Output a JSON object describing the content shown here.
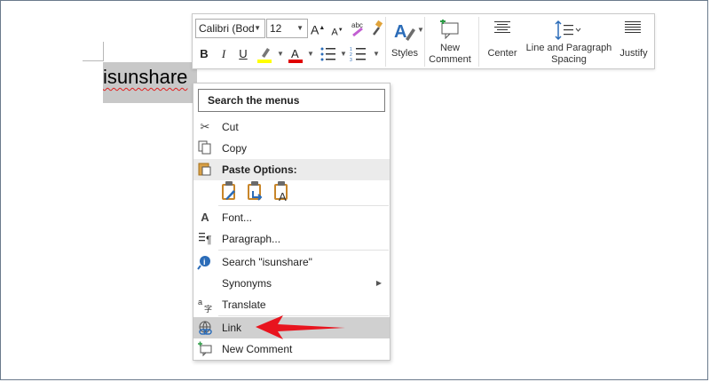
{
  "document": {
    "selected_word": "isunshare"
  },
  "mini_toolbar": {
    "font_name": "Calibri (Bod",
    "font_size": "12",
    "bold": "B",
    "italic": "I",
    "underline": "U",
    "styles_label": "Styles",
    "new_comment_label_1": "New",
    "new_comment_label_2": "Comment",
    "center_label": "Center",
    "line_spacing_label_1": "Line and Paragraph",
    "line_spacing_label_2": "Spacing",
    "justify_label": "Justify",
    "grow_font": "A",
    "shrink_font": "A",
    "font_color_letter": "A",
    "colors": {
      "highlight": "#ffff00",
      "font_color": "#e00000",
      "styles_accent": "#2b6cb8",
      "comment_accent": "#2e9b47"
    }
  },
  "context_menu": {
    "search_label": "Search the menus",
    "items": [
      {
        "label": "Cut",
        "icon": "scissors-icon"
      },
      {
        "label": "Copy",
        "icon": "copy-icon"
      },
      {
        "label": "Paste Options:",
        "icon": "clipboard-icon"
      },
      {
        "label": "Font...",
        "icon": "font-icon"
      },
      {
        "label": "Paragraph...",
        "icon": "paragraph-icon"
      },
      {
        "label": "Search \"isunshare\"",
        "icon": "smart-lookup-icon"
      },
      {
        "label": "Synonyms",
        "icon": ""
      },
      {
        "label": "Translate",
        "icon": "translate-icon"
      },
      {
        "label": "Link",
        "icon": "link-icon"
      },
      {
        "label": "New Comment",
        "icon": "new-comment-icon"
      }
    ],
    "paste_icons": [
      "keep-source-formatting-icon",
      "merge-formatting-icon",
      "keep-text-only-icon"
    ],
    "annotation_arrow_color": "#e8141e"
  }
}
